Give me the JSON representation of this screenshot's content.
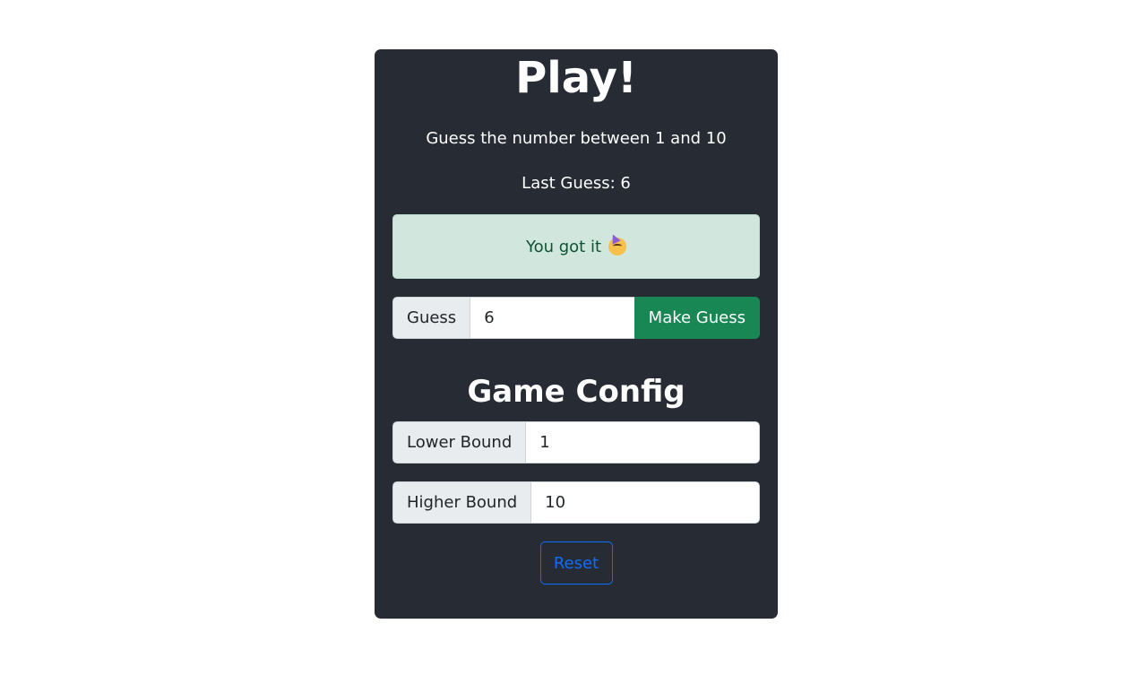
{
  "play": {
    "title": "Play!",
    "subtitle": "Guess the number between 1 and 10",
    "last_guess": "Last Guess: 6",
    "alert_text": "You got it",
    "alert_icon": "party-face-icon"
  },
  "guess": {
    "label": "Guess",
    "value": "6",
    "button_label": "Make Guess"
  },
  "config": {
    "title": "Game Config",
    "lower_label": "Lower Bound",
    "lower_value": "1",
    "higher_label": "Higher Bound",
    "higher_value": "10",
    "reset_label": "Reset"
  },
  "colors": {
    "card_bg": "#272b34",
    "success_alert_bg": "#d1e7dd",
    "success_button": "#198754",
    "primary_outline": "#0d6efd"
  }
}
